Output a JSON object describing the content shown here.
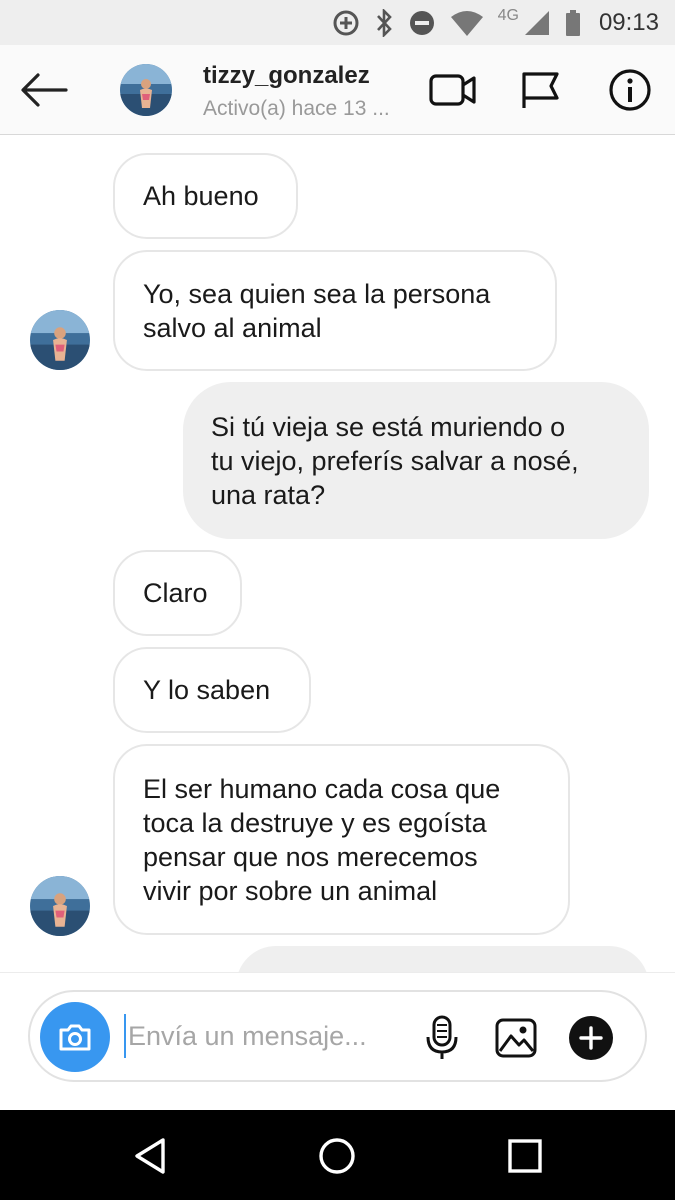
{
  "status_bar": {
    "network": "4G",
    "time": "09:13"
  },
  "header": {
    "username": "tizzy_gonzalez",
    "activity": "Activo(a) hace 13 ...",
    "icons": [
      "back-arrow-icon",
      "video-call-icon",
      "flag-icon",
      "info-icon"
    ]
  },
  "messages": [
    {
      "direction": "incoming",
      "text": "Ah bueno"
    },
    {
      "direction": "incoming",
      "text": "Yo, sea quien sea la persona\nsalvo al animal"
    },
    {
      "direction": "outgoing",
      "text": "Si tú vieja se está muriendo o\ntu viejo, preferís salvar a nosé,\nuna rata?"
    },
    {
      "direction": "incoming",
      "text": "Claro"
    },
    {
      "direction": "incoming",
      "text": "Y lo saben"
    },
    {
      "direction": "incoming",
      "text": "El ser humano cada cosa que\ntoca la destruye y es egoísta\npensar que nos merecemos\nvivir por sobre un animal"
    },
    {
      "direction": "outgoing",
      "text": ""
    }
  ],
  "composer": {
    "placeholder": "Envía un mensaje...",
    "value": "",
    "icons": [
      "camera-icon",
      "microphone-icon",
      "gallery-icon",
      "plus-icon"
    ]
  },
  "nav_bar": {
    "icons": [
      "back-triangle-icon",
      "home-circle-icon",
      "recents-square-icon"
    ]
  },
  "colors": {
    "accent": "#3897f0",
    "outgoing_bubble": "#efefef",
    "incoming_border": "#e6e6e6"
  }
}
